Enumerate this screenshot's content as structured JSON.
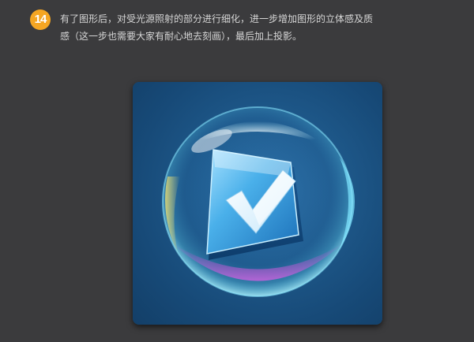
{
  "step": {
    "number": "14",
    "lines": [
      "有了图形后，对受光源照射的部分进行细化，进一步增加图形的立体感及质",
      "感（这一步也需要大家有耐心地去刻画），最后加上投影。"
    ]
  },
  "illustration": {
    "icon_name": "checkmark-bubble-icon",
    "colors": {
      "badge": "#f5a623",
      "card_bg": "#1f5a8c",
      "bubble_rim": "#7fe6ff",
      "check_card": "#4ab0ea",
      "checkmark": "#e9f6ff",
      "magenta_glow": "#c04fd0",
      "yellow_glow": "#f0e070"
    }
  }
}
